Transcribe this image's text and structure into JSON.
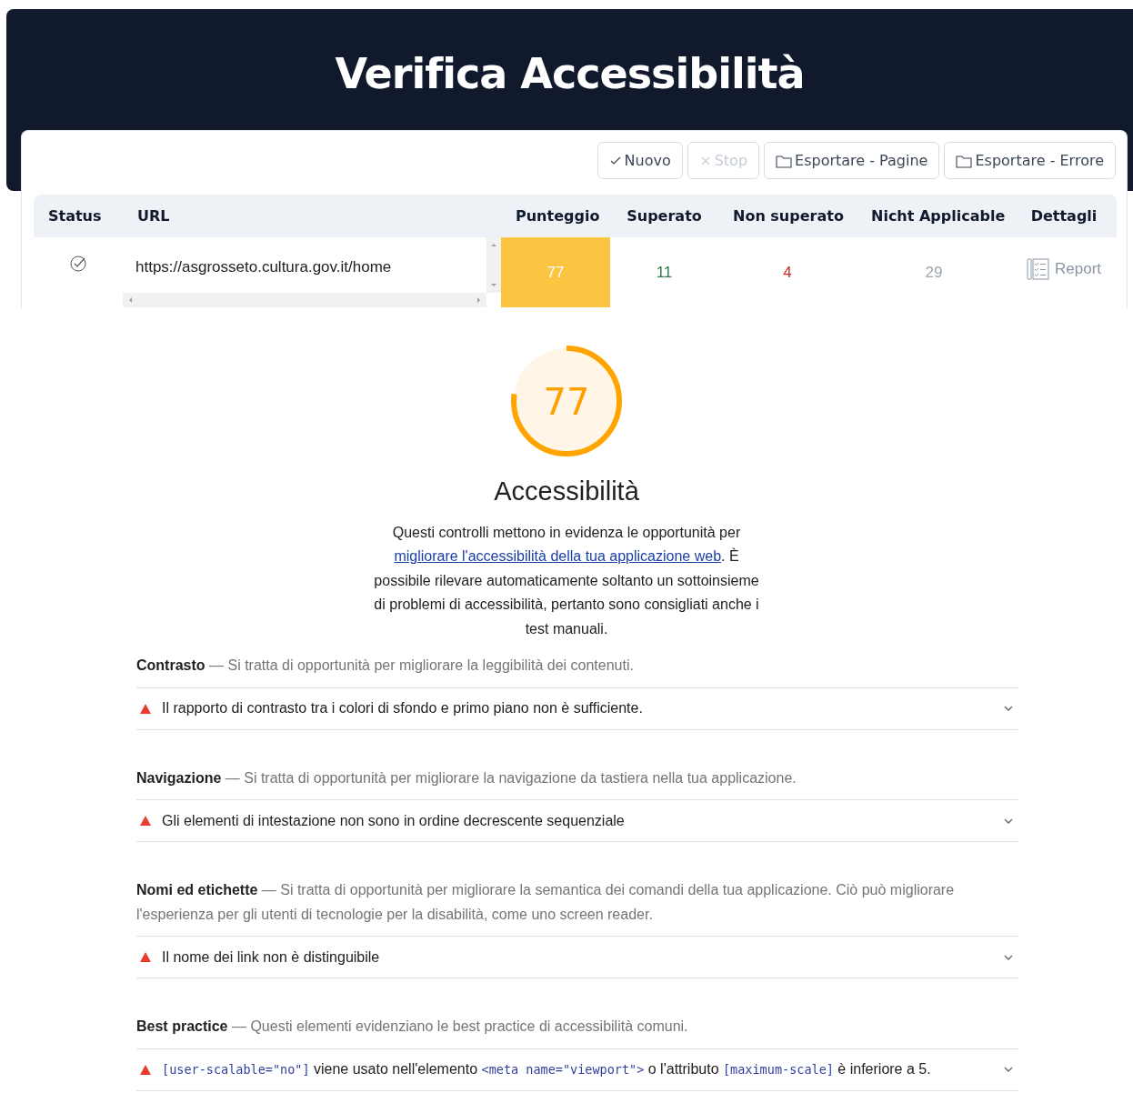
{
  "header": {
    "title": "Verifica Accessibilità"
  },
  "toolbar": {
    "buttons": [
      {
        "label": "Nuovo",
        "kind": "new",
        "disabled": false
      },
      {
        "label": "Stop",
        "kind": "stop",
        "disabled": true
      },
      {
        "label": "Esportare - Pagine",
        "kind": "export",
        "disabled": false
      },
      {
        "label": "Esportare - Errore",
        "kind": "export",
        "disabled": false
      }
    ]
  },
  "table": {
    "columns": [
      "Status",
      "URL",
      "Punteggio",
      "Superato",
      "Non superato",
      "Nicht Applicable",
      "Dettagli"
    ],
    "rows": [
      {
        "url": "https://asgrosseto.cultura.gov.it/home",
        "score": "77",
        "passed": "11",
        "failed": "4",
        "not_applicable": "29",
        "details": "Report"
      }
    ]
  },
  "report": {
    "gauge": {
      "score": "77",
      "level": 0.77
    },
    "title": "Accessibilità",
    "description": [
      {
        "kind": "text",
        "text": "Questi controlli mettono in evidenza le opportunità per "
      },
      {
        "kind": "link",
        "text": "migliorare l'accessibilità della tua applicazione web"
      },
      {
        "kind": "text",
        "text": ". È possibile rilevare automaticamente soltanto un sottoinsieme di problemi di accessibilità, pertanto sono consigliati anche i test manuali."
      }
    ],
    "groups": [
      {
        "heading": "**Contrasto** — Si tratta di opportunità per migliorare la leggibilità dei contenuti.",
        "audits": [
          {
            "expanded": false,
            "segments": [
              {
                "kind": "text",
                "text": "Il rapporto di contrasto tra i colori di sfondo e primo piano non è sufficiente."
              }
            ]
          }
        ]
      },
      {
        "heading": "**Navigazione** — Si tratta di opportunità per migliorare la navigazione da tastiera nella tua applicazione.",
        "audits": [
          {
            "expanded": false,
            "segments": [
              {
                "kind": "text",
                "text": "Gli elementi di intestazione non sono in ordine decrescente sequenziale"
              }
            ]
          }
        ]
      },
      {
        "heading": "**Nomi ed etichette** — Si tratta di opportunità per migliorare la semantica dei comandi della tua applicazione. Ciò può migliorare l'esperienza per gli utenti di tecnologie per la disabilità, come uno screen reader.",
        "audits": [
          {
            "expanded": false,
            "segments": [
              {
                "kind": "text",
                "text": "Il nome dei link non è distinguibile"
              }
            ]
          }
        ]
      },
      {
        "heading": "**Best practice** — Questi elementi evidenziano le best practice di accessibilità comuni.",
        "audits": [
          {
            "expanded": false,
            "segments": [
              {
                "kind": "code",
                "text": "[user-scalable=\"no\"]"
              },
              {
                "kind": "text",
                "text": " viene usato nell'elemento "
              },
              {
                "kind": "code",
                "text": "<meta name=\"viewport\">"
              },
              {
                "kind": "text",
                "text": " o l'attributo "
              },
              {
                "kind": "code",
                "text": "[maximum-scale]"
              },
              {
                "kind": "text",
                "text": " è inferiore a 5."
              }
            ]
          }
        ]
      }
    ]
  }
}
